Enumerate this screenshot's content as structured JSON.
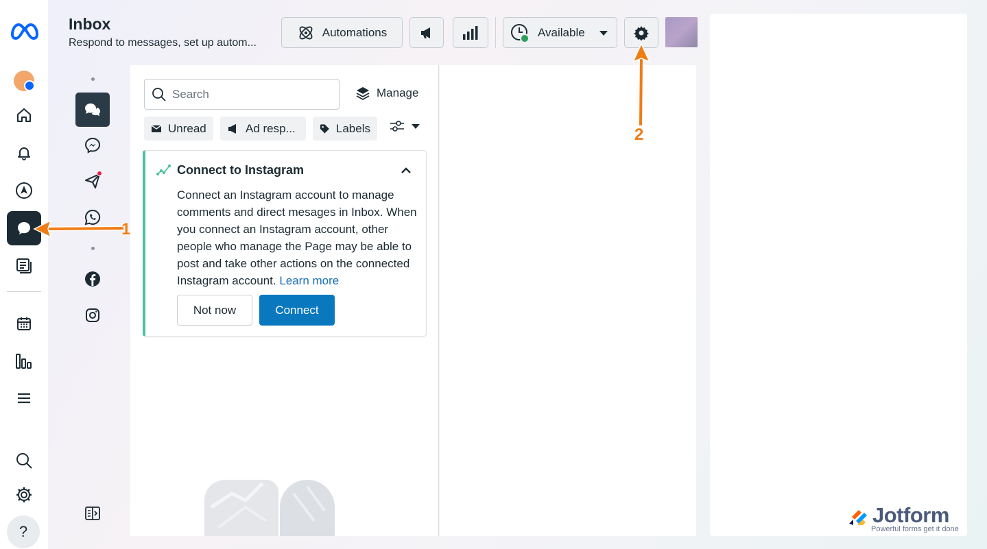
{
  "header": {
    "title": "Inbox",
    "subtitle": "Respond to messages, set up autom...",
    "automations_label": "Automations",
    "availability_label": "Available"
  },
  "list": {
    "search_placeholder": "Search",
    "manage_label": "Manage",
    "filters": [
      {
        "label": "Unread"
      },
      {
        "label": "Ad resp..."
      },
      {
        "label": "Labels"
      }
    ]
  },
  "card": {
    "title": "Connect to Instagram",
    "body": "Connect an Instagram account to manage comments and direct mesages in Inbox. When you connect an Instagram account, other people who manage the Page may be able to post and take other actions on the connected Instagram account.",
    "learn_more": "Learn more",
    "not_now_label": "Not now",
    "connect_label": "Connect"
  },
  "nav": {
    "help_label": "?"
  },
  "annotations": {
    "arrow_1": "1",
    "arrow_2": "2"
  },
  "watermark": {
    "brand": "Jotform",
    "tagline": "Powerful forms get it done"
  },
  "colors": {
    "accent_green": "#4bc2a0",
    "primary_blue": "#0a78be",
    "annotation_orange": "#f07c15",
    "status_green": "#2e9e5b",
    "dark_nav": "#1c2b33"
  }
}
